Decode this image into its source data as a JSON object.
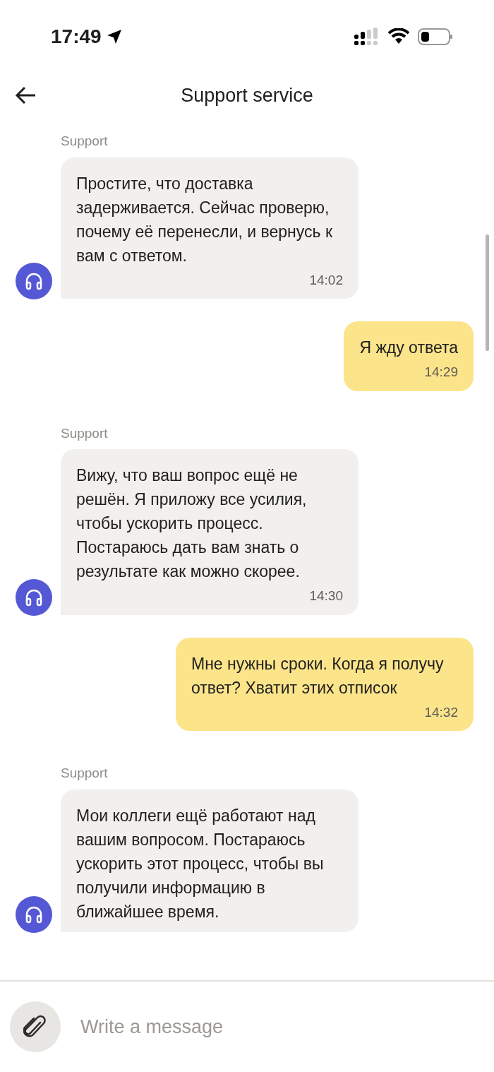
{
  "status_bar": {
    "time": "17:49"
  },
  "header": {
    "title": "Support service"
  },
  "messages": [
    {
      "kind": "incoming",
      "sender": "Support",
      "text": "Простите, что доставка задерживается. Сейчас проверю, почему её перенесли, и вернусь к вам с ответом.",
      "time": "14:02"
    },
    {
      "kind": "outgoing",
      "text": "Я жду ответа",
      "time": "14:29"
    },
    {
      "kind": "incoming",
      "sender": "Support",
      "text": "Вижу, что ваш вопрос ещё не решён. Я приложу все усилия, чтобы ускорить процесс. Постараюсь дать вам знать о результате как можно скорее.",
      "time": "14:30"
    },
    {
      "kind": "outgoing",
      "text": "Мне нужны сроки. Когда я получу ответ? Хватит этих отписок",
      "time": "14:32"
    },
    {
      "kind": "incoming",
      "sender": "Support",
      "text": "Мои коллеги ещё работают над вашим вопросом. Постараюсь ускорить этот процесс, чтобы вы получили информацию в ближайшее время."
    }
  ],
  "composer": {
    "placeholder": "Write a message"
  }
}
